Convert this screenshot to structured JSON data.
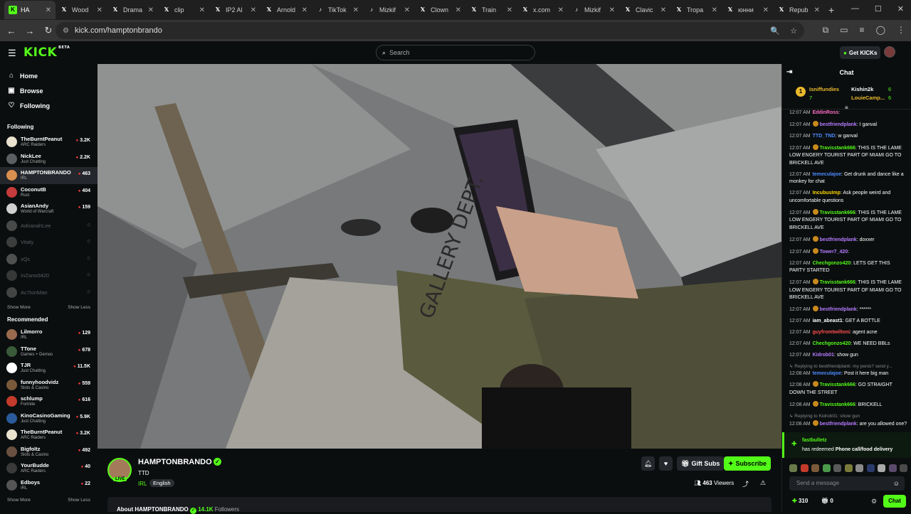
{
  "browser": {
    "tabs": [
      {
        "label": "HA",
        "icon": "kick-icon",
        "color": "#53fc18",
        "active": true
      },
      {
        "label": "Wood",
        "icon": "x-icon"
      },
      {
        "label": "Drama",
        "icon": "x-icon"
      },
      {
        "label": "clip",
        "icon": "x-icon"
      },
      {
        "label": "IP2 Al",
        "icon": "x-icon"
      },
      {
        "label": "Arnold",
        "icon": "x-icon"
      },
      {
        "label": "TikTok",
        "icon": "tiktok-icon"
      },
      {
        "label": "Mizkif",
        "icon": "tiktok-icon"
      },
      {
        "label": "Clown",
        "icon": "x-icon"
      },
      {
        "label": "Train",
        "icon": "x-icon"
      },
      {
        "label": "x.com",
        "icon": "x-icon"
      },
      {
        "label": "Mizkif",
        "icon": "tiktok-icon"
      },
      {
        "label": "Clavic",
        "icon": "x-icon"
      },
      {
        "label": "Tropa",
        "icon": "x-icon"
      },
      {
        "label": "юнни",
        "icon": "x-icon"
      },
      {
        "label": "Repub",
        "icon": "x-icon"
      }
    ],
    "url": "kick.com/hamptonbrando"
  },
  "header": {
    "logo": "KICK",
    "logo_beta": "BETA",
    "search_placeholder": "Search",
    "get_kicks": "Get KICKs"
  },
  "sidebar": {
    "nav": [
      {
        "label": "Home",
        "icon": "home-icon"
      },
      {
        "label": "Browse",
        "icon": "browse-icon"
      },
      {
        "label": "Following",
        "icon": "heart-icon"
      }
    ],
    "following_title": "Following",
    "following": [
      {
        "name": "TheBurntPeanut",
        "category": "ARC Raiders",
        "viewers": "3.2K",
        "color": "#e8e2cf"
      },
      {
        "name": "NickLee",
        "category": "Just Chatting",
        "viewers": "2.2K",
        "color": "#5c5f62"
      },
      {
        "name": "HAMPTONBRANDO",
        "category": "IRL",
        "viewers": "463",
        "color": "#d98f4e",
        "active": true
      },
      {
        "name": "CoconutB",
        "category": "Rust",
        "viewers": "404",
        "color": "#c63b3b"
      },
      {
        "name": "AsianAndy",
        "category": "World of Warcraft",
        "viewers": "159",
        "color": "#d0d0d0"
      },
      {
        "name": "AdrianahLee",
        "offline": true,
        "color": "#bbbbbb"
      },
      {
        "name": "Vitaly",
        "offline": true,
        "color": "#999999"
      },
      {
        "name": "xQc",
        "offline": true,
        "color": "#cccccc"
      },
      {
        "name": "InZano0420",
        "offline": true,
        "color": "#888888"
      },
      {
        "name": "Ac7ionMan",
        "offline": true,
        "color": "#aaaaaa"
      }
    ],
    "show_more": "Show More",
    "show_less": "Show Less",
    "recommended_title": "Recommended",
    "recommended": [
      {
        "name": "Lilmorro",
        "category": "IRL",
        "viewers": "129",
        "color": "#9a6b4f"
      },
      {
        "name": "TTone",
        "category": "Games + Demos",
        "viewers": "678",
        "color": "#3a5a3a"
      },
      {
        "name": "TJR",
        "category": "Just Chatting",
        "viewers": "11.5K",
        "color": "#ffffff"
      },
      {
        "name": "funnyhoodvidz",
        "category": "Slots & Casino",
        "viewers": "559",
        "color": "#7a5a3a"
      },
      {
        "name": "schlump",
        "category": "Fortnite",
        "viewers": "616",
        "color": "#c43b2b"
      },
      {
        "name": "KinoCasinoGaming",
        "category": "Just Chatting",
        "viewers": "5.9K",
        "color": "#2a5a9a"
      },
      {
        "name": "TheBurntPeanut",
        "category": "ARC Raiders",
        "viewers": "3.2K",
        "color": "#e8e2cf"
      },
      {
        "name": "Bigfoltz",
        "category": "Slots & Casino",
        "viewers": "492",
        "color": "#6a5040"
      },
      {
        "name": "YourBudde",
        "category": "ARC Raiders",
        "viewers": "40",
        "color": "#3a3a3a"
      },
      {
        "name": "Edboys",
        "category": "IRL",
        "viewers": "22",
        "color": "#555555"
      }
    ]
  },
  "stream": {
    "channel": "HAMPTONBRANDO",
    "live": "LIVE",
    "title": "TTD",
    "category": "IRL",
    "language": "English",
    "gift_subs": "Gift Subs",
    "subscribe": "Subscribe",
    "viewers": "463",
    "viewers_label": "Viewers",
    "about_label": "About HAMPTONBRANDO",
    "followers": "14.1K",
    "followers_label": "Followers"
  },
  "chat": {
    "title": "Chat",
    "top_gifters": [
      {
        "rank": "1",
        "name": "Isniffundies",
        "count": "7",
        "color": "#e8b92c"
      },
      {
        "name": "Kishin2k",
        "count": "6",
        "color": "#ffffff"
      },
      {
        "name": "LouieCamp...",
        "count": "6",
        "color": "#e8b92c"
      }
    ],
    "messages": [
      {
        "time": "12:07 AM",
        "user": "EddinRoss",
        "color": "#ff6ec7",
        "text": "",
        "badge": false
      },
      {
        "time": "12:07 AM",
        "user": "bestfriendplank",
        "color": "#b57bff",
        "text": "I ganval",
        "badge": true
      },
      {
        "time": "12:07 AM",
        "user": "TTD_TND",
        "color": "#4b8bff",
        "text": "w ganval",
        "badge": false
      },
      {
        "time": "12:07 AM",
        "user": "Travisstank666",
        "color": "#53fc18",
        "text": "THIS IS THE LAME LOW ENGERY TOURIST PART OF MIAMI GO TO BRICKELL AVE",
        "badge": true
      },
      {
        "time": "12:07 AM",
        "user": "temeculajoe",
        "color": "#4b8bff",
        "text": "Get drunk and dance like a monkey for chat",
        "badge": false
      },
      {
        "time": "12:07 AM",
        "user": "IncubusImp",
        "color": "#ffd700",
        "text": "Ask people weird and uncomfortable questions",
        "badge": false
      },
      {
        "time": "12:07 AM",
        "user": "Travisstank666",
        "color": "#53fc18",
        "text": "THIS IS THE LAME LOW ENGERY TOURIST PART OF MIAMI GO TO BRICKELL AVE",
        "badge": true
      },
      {
        "time": "12:07 AM",
        "user": "bestfriendplank",
        "color": "#b57bff",
        "text": "doxxer",
        "badge": true
      },
      {
        "time": "12:07 AM",
        "user": "Tower7_420",
        "color": "#b57bff",
        "text": "",
        "badge": true
      },
      {
        "time": "12:07 AM",
        "user": "Chechgonzo420",
        "color": "#53fc18",
        "text": "LETS GET THIS PARTY STARTED",
        "badge": false
      },
      {
        "time": "12:07 AM",
        "user": "Travisstank666",
        "color": "#53fc18",
        "text": "THIS IS THE LAME LOW ENGERY TOURIST PART OF MIAMI GO TO BRICKELL AVE",
        "badge": true
      },
      {
        "time": "12:07 AM",
        "user": "bestfriendplank",
        "color": "#b57bff",
        "text": "******",
        "badge": true
      },
      {
        "time": "12:07 AM",
        "user": "iam_abeast1",
        "color": "#ffffff",
        "text": "GET A BOTTLE",
        "badge": false
      },
      {
        "time": "12:07 AM",
        "user": "guyfromtwiltoni",
        "color": "#ff4d4d",
        "text": "agent acne",
        "badge": false
      },
      {
        "time": "12:07 AM",
        "user": "Chechgonzo420",
        "color": "#53fc18",
        "text": "WE NEED BBLs",
        "badge": false
      },
      {
        "time": "12:07 AM",
        "user": "Kidrob01",
        "color": "#b57bff",
        "text": "show gun",
        "badge": false
      },
      {
        "reply": "Replying to bestfriendplank: my penis? send y...",
        "time": "12:08 AM",
        "user": "temeculajoe",
        "color": "#4b8bff",
        "text": "Post it here big man",
        "badge": false
      },
      {
        "time": "12:08 AM",
        "user": "Travisstank666",
        "color": "#53fc18",
        "text": "GO STRAIGHT DOWN THE STREET",
        "badge": true
      },
      {
        "time": "12:08 AM",
        "user": "Travisstank666",
        "color": "#53fc18",
        "text": "BRICKELL",
        "badge": true
      },
      {
        "reply": "Replying to Kidrob01: show gun",
        "time": "12:08 AM",
        "user": "bestfriendplank",
        "color": "#b57bff",
        "text": "are you allowed one?",
        "badge": true
      }
    ],
    "redeem": {
      "user": "fastbulletz",
      "prefix": "has redeemed",
      "reward": "Phone call/food delivery"
    },
    "input_placeholder": "Send a message",
    "kicks": "310",
    "gifts": "0",
    "chat_button": "Chat"
  }
}
